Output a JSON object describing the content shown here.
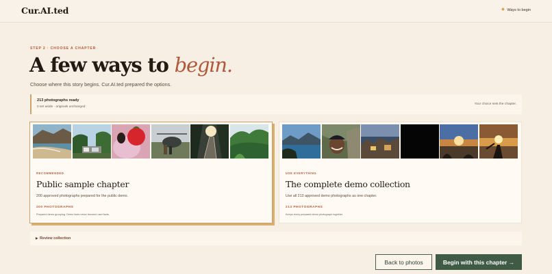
{
  "header": {
    "logo": "Cur.AI.ted",
    "ways_link": "Ways to begin",
    "ways_icon": "star-icon"
  },
  "intro": {
    "step": "STEP 2 · CHOOSE A CHAPTER",
    "headline_main": "A few ways to ",
    "headline_accent": "begin.",
    "subtitle": "Choose where this story begins. Cur.AI.ted prepared the options."
  },
  "status": {
    "title": "213 photographs ready",
    "subtitle": "0 set aside · originals unchanged",
    "right_note": "Your choice sets the chapter."
  },
  "cards": [
    {
      "tag": "RECOMMENDED",
      "title": "Public sample chapter",
      "description": "200 approved photographs prepared for the public demo.",
      "count": "200 PHOTOGRAPHS",
      "note": "Prepared demo grouping. Demo facts never become user facts.",
      "selected": true
    },
    {
      "tag": "USE EVERYTHING",
      "title": "The complete demo collection",
      "description": "Use all 213 approved demo photographs as one chapter.",
      "count": "213 PHOTOGRAPHS",
      "note": "Keeps every prepared demo photograph together.",
      "selected": false
    }
  ],
  "review": {
    "label": "Review collection",
    "caret_icon": "caret-right-icon"
  },
  "actions": {
    "back": "Back to photos",
    "begin": "Begin with this chapter →"
  },
  "colors": {
    "background": "#f7efe3",
    "accent": "#b65a38",
    "primary_button": "#3f5a45",
    "selected_border": "#c9a06a"
  }
}
